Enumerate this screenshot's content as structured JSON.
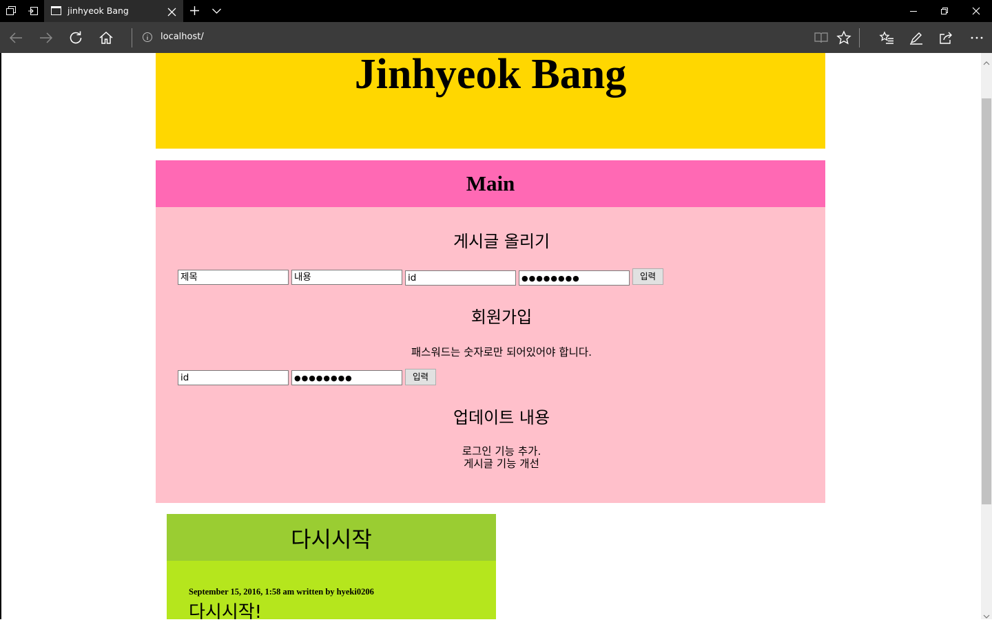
{
  "browser": {
    "tab_title": "jinhyeok Bang",
    "address": "localhost/"
  },
  "page": {
    "site_title": "Jinhyeok Bang",
    "main_title": "Main",
    "post_form": {
      "title": "게시글 올리기",
      "subject_value": "제목",
      "content_value": "내용",
      "id_value": "id",
      "password_value": "●●●●●●●●",
      "submit_label": "입력"
    },
    "signup_form": {
      "title": "회원가입",
      "note": "패스워드는 숫자로만 되어있어야 합니다.",
      "id_value": "id",
      "password_value": "●●●●●●●●",
      "submit_label": "입력"
    },
    "updates": {
      "title": "업데이트 내용",
      "lines": [
        "로그인 기능 추가.",
        "게시글 기능 개선"
      ]
    },
    "post": {
      "header": "다시시작",
      "meta": "September 15, 2016, 1:58 am written by hyeki0206",
      "heading": "다시시작!"
    }
  }
}
